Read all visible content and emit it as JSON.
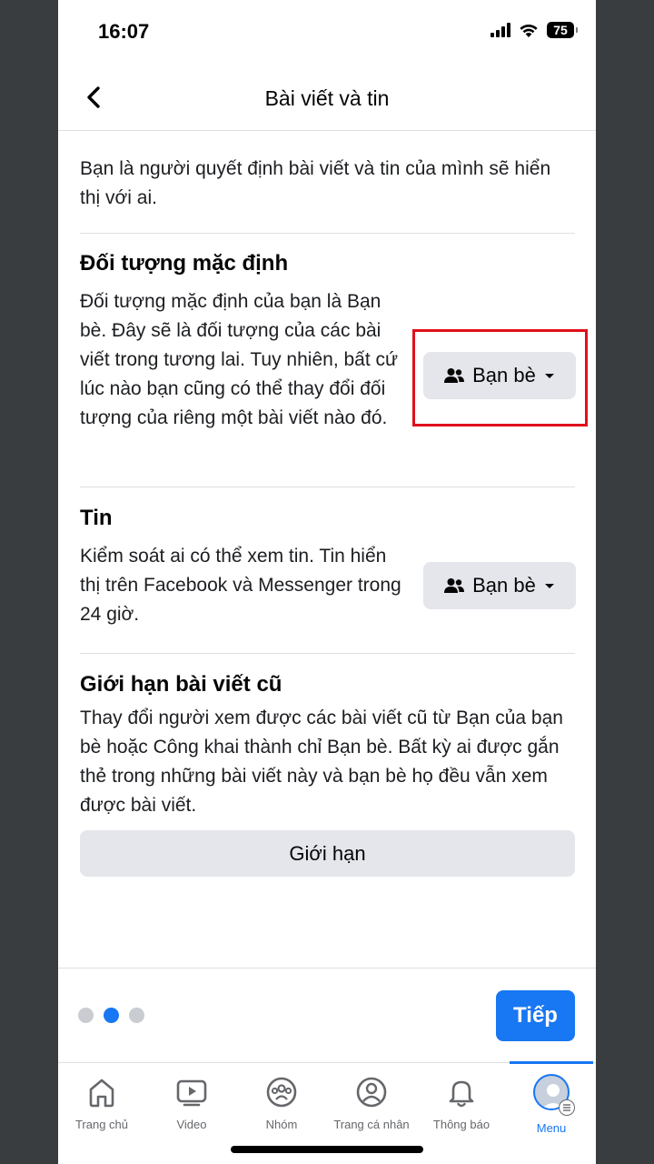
{
  "status": {
    "time": "16:07",
    "battery": "75"
  },
  "header": {
    "title": "Bài viết và tin"
  },
  "intro": "Bạn là người quyết định bài viết và tin của mình sẽ hiển thị với ai.",
  "default_audience": {
    "title": "Đối tượng mặc định",
    "description": "Đối tượng mặc định của bạn là Bạn bè. Đây sẽ là đối tượng của các bài viết trong tương lai. Tuy nhiên, bất cứ lúc nào bạn cũng có thể thay đổi đối tượng của riêng một bài viết nào đó.",
    "button_label": "Bạn bè"
  },
  "stories": {
    "title": "Tin",
    "description": "Kiểm soát ai có thể xem tin. Tin hiển thị trên Facebook và Messenger trong 24 giờ.",
    "button_label": "Bạn bè"
  },
  "limit_past": {
    "title": "Giới hạn bài viết cũ",
    "description": "Thay đổi người xem được các bài viết cũ từ Bạn của bạn bè hoặc Công khai thành chỉ Bạn bè. Bất kỳ ai được gắn thẻ trong những bài viết này và bạn bè họ đều vẫn xem được bài viết.",
    "button_label": "Giới hạn"
  },
  "pagination": {
    "total": 3,
    "active": 2
  },
  "next_button": "Tiếp",
  "tabs": [
    {
      "label": "Trang chủ",
      "icon": "home-icon"
    },
    {
      "label": "Video",
      "icon": "video-icon"
    },
    {
      "label": "Nhóm",
      "icon": "groups-icon"
    },
    {
      "label": "Trang cá nhân",
      "icon": "profile-icon"
    },
    {
      "label": "Thông báo",
      "icon": "bell-icon"
    },
    {
      "label": "Menu",
      "icon": "menu-avatar-icon"
    }
  ],
  "colors": {
    "accent": "#1877f2",
    "highlight": "#e0101b"
  }
}
